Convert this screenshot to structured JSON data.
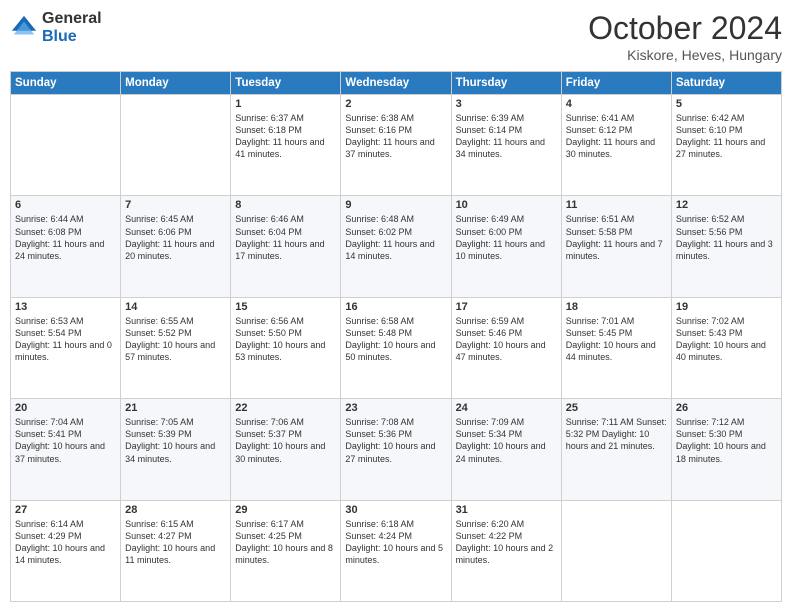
{
  "header": {
    "logo_general": "General",
    "logo_blue": "Blue",
    "month_title": "October 2024",
    "location": "Kiskore, Heves, Hungary"
  },
  "weekdays": [
    "Sunday",
    "Monday",
    "Tuesday",
    "Wednesday",
    "Thursday",
    "Friday",
    "Saturday"
  ],
  "weeks": [
    [
      {
        "day": "",
        "detail": ""
      },
      {
        "day": "",
        "detail": ""
      },
      {
        "day": "1",
        "detail": "Sunrise: 6:37 AM\nSunset: 6:18 PM\nDaylight: 11 hours and 41 minutes."
      },
      {
        "day": "2",
        "detail": "Sunrise: 6:38 AM\nSunset: 6:16 PM\nDaylight: 11 hours and 37 minutes."
      },
      {
        "day": "3",
        "detail": "Sunrise: 6:39 AM\nSunset: 6:14 PM\nDaylight: 11 hours and 34 minutes."
      },
      {
        "day": "4",
        "detail": "Sunrise: 6:41 AM\nSunset: 6:12 PM\nDaylight: 11 hours and 30 minutes."
      },
      {
        "day": "5",
        "detail": "Sunrise: 6:42 AM\nSunset: 6:10 PM\nDaylight: 11 hours and 27 minutes."
      }
    ],
    [
      {
        "day": "6",
        "detail": "Sunrise: 6:44 AM\nSunset: 6:08 PM\nDaylight: 11 hours and 24 minutes."
      },
      {
        "day": "7",
        "detail": "Sunrise: 6:45 AM\nSunset: 6:06 PM\nDaylight: 11 hours and 20 minutes."
      },
      {
        "day": "8",
        "detail": "Sunrise: 6:46 AM\nSunset: 6:04 PM\nDaylight: 11 hours and 17 minutes."
      },
      {
        "day": "9",
        "detail": "Sunrise: 6:48 AM\nSunset: 6:02 PM\nDaylight: 11 hours and 14 minutes."
      },
      {
        "day": "10",
        "detail": "Sunrise: 6:49 AM\nSunset: 6:00 PM\nDaylight: 11 hours and 10 minutes."
      },
      {
        "day": "11",
        "detail": "Sunrise: 6:51 AM\nSunset: 5:58 PM\nDaylight: 11 hours and 7 minutes."
      },
      {
        "day": "12",
        "detail": "Sunrise: 6:52 AM\nSunset: 5:56 PM\nDaylight: 11 hours and 3 minutes."
      }
    ],
    [
      {
        "day": "13",
        "detail": "Sunrise: 6:53 AM\nSunset: 5:54 PM\nDaylight: 11 hours and 0 minutes."
      },
      {
        "day": "14",
        "detail": "Sunrise: 6:55 AM\nSunset: 5:52 PM\nDaylight: 10 hours and 57 minutes."
      },
      {
        "day": "15",
        "detail": "Sunrise: 6:56 AM\nSunset: 5:50 PM\nDaylight: 10 hours and 53 minutes."
      },
      {
        "day": "16",
        "detail": "Sunrise: 6:58 AM\nSunset: 5:48 PM\nDaylight: 10 hours and 50 minutes."
      },
      {
        "day": "17",
        "detail": "Sunrise: 6:59 AM\nSunset: 5:46 PM\nDaylight: 10 hours and 47 minutes."
      },
      {
        "day": "18",
        "detail": "Sunrise: 7:01 AM\nSunset: 5:45 PM\nDaylight: 10 hours and 44 minutes."
      },
      {
        "day": "19",
        "detail": "Sunrise: 7:02 AM\nSunset: 5:43 PM\nDaylight: 10 hours and 40 minutes."
      }
    ],
    [
      {
        "day": "20",
        "detail": "Sunrise: 7:04 AM\nSunset: 5:41 PM\nDaylight: 10 hours and 37 minutes."
      },
      {
        "day": "21",
        "detail": "Sunrise: 7:05 AM\nSunset: 5:39 PM\nDaylight: 10 hours and 34 minutes."
      },
      {
        "day": "22",
        "detail": "Sunrise: 7:06 AM\nSunset: 5:37 PM\nDaylight: 10 hours and 30 minutes."
      },
      {
        "day": "23",
        "detail": "Sunrise: 7:08 AM\nSunset: 5:36 PM\nDaylight: 10 hours and 27 minutes."
      },
      {
        "day": "24",
        "detail": "Sunrise: 7:09 AM\nSunset: 5:34 PM\nDaylight: 10 hours and 24 minutes."
      },
      {
        "day": "25",
        "detail": "Sunrise: 7:11 AM\nSunset: 5:32 PM\nDaylight: 10 hours and 21 minutes."
      },
      {
        "day": "26",
        "detail": "Sunrise: 7:12 AM\nSunset: 5:30 PM\nDaylight: 10 hours and 18 minutes."
      }
    ],
    [
      {
        "day": "27",
        "detail": "Sunrise: 6:14 AM\nSunset: 4:29 PM\nDaylight: 10 hours and 14 minutes."
      },
      {
        "day": "28",
        "detail": "Sunrise: 6:15 AM\nSunset: 4:27 PM\nDaylight: 10 hours and 11 minutes."
      },
      {
        "day": "29",
        "detail": "Sunrise: 6:17 AM\nSunset: 4:25 PM\nDaylight: 10 hours and 8 minutes."
      },
      {
        "day": "30",
        "detail": "Sunrise: 6:18 AM\nSunset: 4:24 PM\nDaylight: 10 hours and 5 minutes."
      },
      {
        "day": "31",
        "detail": "Sunrise: 6:20 AM\nSunset: 4:22 PM\nDaylight: 10 hours and 2 minutes."
      },
      {
        "day": "",
        "detail": ""
      },
      {
        "day": "",
        "detail": ""
      }
    ]
  ]
}
